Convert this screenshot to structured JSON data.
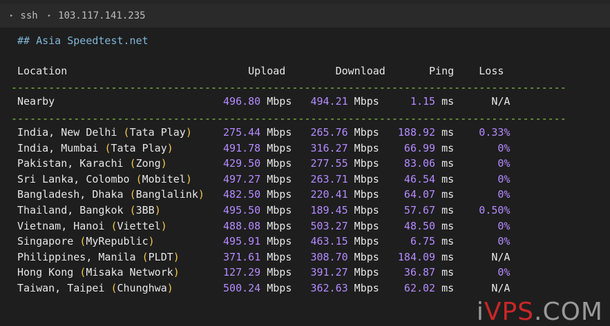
{
  "titlebar": {
    "items": [
      "ssh",
      "103.117.141.235"
    ]
  },
  "terminal": {
    "heading": "## Asia Speedtest.net",
    "columns": [
      "Location",
      "Upload",
      "Download",
      "Ping",
      "Loss"
    ],
    "dash_line": "-----------------------------------------------------------------------------------------",
    "nearby": {
      "location": "Nearby",
      "provider": "",
      "upload": "496.80",
      "download": "494.21",
      "ping": "1.15",
      "loss": "N/A"
    },
    "rows": [
      {
        "location": "India, New Delhi",
        "provider": "Tata Play",
        "upload": "275.44",
        "download": "265.76",
        "ping": "188.92",
        "loss": "0.33%"
      },
      {
        "location": "India, Mumbai",
        "provider": "Tata Play",
        "upload": "491.78",
        "download": "316.27",
        "ping": "66.99",
        "loss": "0%"
      },
      {
        "location": "Pakistan, Karachi",
        "provider": "Zong",
        "upload": "429.50",
        "download": "277.55",
        "ping": "83.06",
        "loss": "0%"
      },
      {
        "location": "Sri Lanka, Colombo",
        "provider": "Mobitel",
        "upload": "497.27",
        "download": "263.71",
        "ping": "46.54",
        "loss": "0%"
      },
      {
        "location": "Bangladesh, Dhaka",
        "provider": "Banglalink",
        "upload": "482.50",
        "download": "220.41",
        "ping": "64.07",
        "loss": "0%"
      },
      {
        "location": "Thailand, Bangkok",
        "provider": "3BB",
        "upload": "495.50",
        "download": "189.45",
        "ping": "57.67",
        "loss": "0.50%"
      },
      {
        "location": "Vietnam, Hanoi",
        "provider": "Viettel",
        "upload": "488.08",
        "download": "503.27",
        "ping": "48.50",
        "loss": "0%"
      },
      {
        "location": "Singapore",
        "provider": "MyRepublic",
        "upload": "495.91",
        "download": "463.15",
        "ping": "6.75",
        "loss": "0%"
      },
      {
        "location": "Philippines, Manila",
        "provider": "PLDT",
        "upload": "371.61",
        "download": "308.70",
        "ping": "184.09",
        "loss": "N/A"
      },
      {
        "location": "Hong Kong",
        "provider": "Misaka Network",
        "upload": "127.29",
        "download": "391.27",
        "ping": "36.87",
        "loss": "0%"
      },
      {
        "location": "Taiwan, Taipei",
        "provider": "Chunghwa",
        "upload": "500.24",
        "download": "362.63",
        "ping": "62.02",
        "loss": "N/A"
      }
    ],
    "units": {
      "speed": "Mbps",
      "ping": "ms"
    }
  },
  "watermark": {
    "text": "iVPS.COM"
  },
  "colors": {
    "background": "#1e1e1e",
    "number": "#b48bff",
    "provider": "#f2c94c",
    "divider": "#8bc34a",
    "heading": "#7fb6d6"
  }
}
